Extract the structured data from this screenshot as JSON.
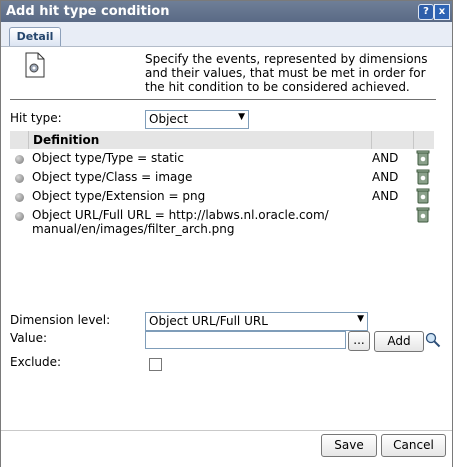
{
  "window": {
    "title": "Add hit type condition",
    "help_label": "?",
    "close_label": "x"
  },
  "tabs": [
    {
      "label": "Detail"
    }
  ],
  "description": "Specify the events, represented by dimensions and their values, that must be met in order for the hit condition to be considered achieved.",
  "hit_type": {
    "label": "Hit type:",
    "selected": "Object"
  },
  "grid": {
    "column_header": "Definition",
    "rows": [
      {
        "text": "Object type/Type = static",
        "operator": "AND"
      },
      {
        "text": "Object type/Class = image",
        "operator": "AND"
      },
      {
        "text": "Object type/Extension = png",
        "operator": "AND"
      },
      {
        "text": "Object URL/Full URL = http://labws.nl.oracle.com/\nmanual/en/images/filter_arch.png",
        "operator": ""
      }
    ]
  },
  "dimension_level": {
    "label": "Dimension level:",
    "selected": "Object URL/Full URL"
  },
  "value": {
    "label": "Value:",
    "value": "",
    "browse_label": "...",
    "add_label": "Add"
  },
  "exclude": {
    "label": "Exclude:",
    "checked": false
  },
  "footer": {
    "save_label": "Save",
    "cancel_label": "Cancel"
  },
  "icons": {
    "header": "document-gear-icon",
    "trash": "trash-icon",
    "search": "search-icon"
  }
}
